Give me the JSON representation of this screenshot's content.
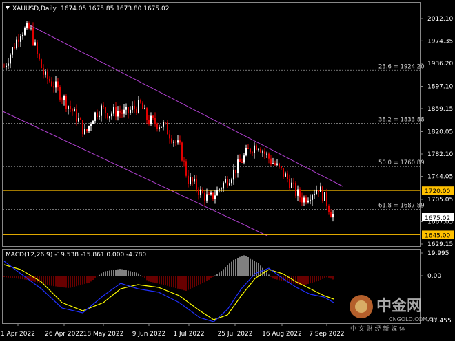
{
  "header": {
    "symbol_label": "XAUUSD,Daily",
    "ohlc_text": "1674.05 1675.85 1673.80 1675.02"
  },
  "price_axis": {
    "ticks": [
      "2012.10",
      "1974.35",
      "1936.20",
      "1897.10",
      "1859.15",
      "1820.05",
      "1782.10",
      "1744.05",
      "1705.05",
      "1667.05",
      "1629.15"
    ],
    "current_price": "1675.02"
  },
  "horizontal_levels": [
    {
      "label": "1720.00",
      "price": 1720.0,
      "color": "#FFC000"
    },
    {
      "label": "1645.00",
      "price": 1645.0,
      "color": "#FFC000"
    }
  ],
  "fibonacci_levels": [
    {
      "label": "23.6 = 1924.20",
      "price": 1924.2
    },
    {
      "label": "38.2 = 1833.88",
      "price": 1833.88
    },
    {
      "label": "50.0 = 1760.89",
      "price": 1760.89
    },
    {
      "label": "61.8 = 1687.89",
      "price": 1687.89
    }
  ],
  "macd": {
    "label": "MACD(12,26,9) -19.538 -15.861 0.000 -4.780",
    "axis_ticks": [
      "19.995",
      "0.00",
      "-37.455"
    ]
  },
  "time_axis": {
    "labels": [
      "1 Apr 2022",
      "26 Apr 2022",
      "18 May 2022",
      "9 Jun 2022",
      "1 Jul 2022",
      "25 Jul 2022",
      "16 Aug 2022",
      "7 Sep 2022"
    ]
  },
  "watermark": {
    "brand": "中金网",
    "domain": "CNGOLD.COM.CN",
    "tagline": "中 文 财 经 新 媒 体"
  },
  "colors": {
    "background": "#000000",
    "bull_candle": "#FFFFFF",
    "bear_candle": "#E00000",
    "channel": "#B040D0",
    "level": "#FFC000",
    "macd_signal": "#FFFF00",
    "macd_line": "#2030FF"
  }
}
